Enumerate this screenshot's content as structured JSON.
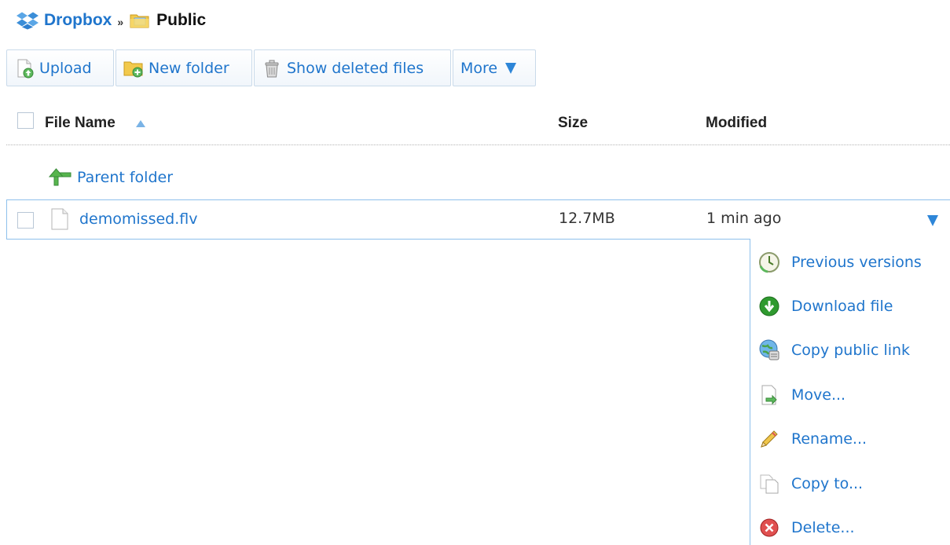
{
  "breadcrumb": {
    "root": "Dropbox",
    "separator": "»",
    "current": "Public"
  },
  "toolbar": {
    "upload": "Upload",
    "new_folder": "New folder",
    "show_deleted": "Show deleted files",
    "more": "More"
  },
  "columns": {
    "name": "File Name",
    "size": "Size",
    "modified": "Modified"
  },
  "parent_folder": "Parent folder",
  "file": {
    "name": "demomissed.flv",
    "size": "12.7MB",
    "modified": "1 min ago"
  },
  "menu": {
    "items": [
      {
        "label": "Previous versions",
        "icon": "clock-icon"
      },
      {
        "label": "Download file",
        "icon": "download-icon"
      },
      {
        "label": "Copy public link",
        "icon": "globe-link-icon"
      },
      {
        "label": "Move...",
        "icon": "move-icon"
      },
      {
        "label": "Rename...",
        "icon": "pencil-icon"
      },
      {
        "label": "Copy to...",
        "icon": "copy-icon"
      },
      {
        "label": "Delete...",
        "icon": "delete-icon"
      }
    ]
  },
  "colors": {
    "link": "#1f75cc",
    "accent_arrow": "#2e86d8",
    "selection_border": "#8ec0ec"
  }
}
